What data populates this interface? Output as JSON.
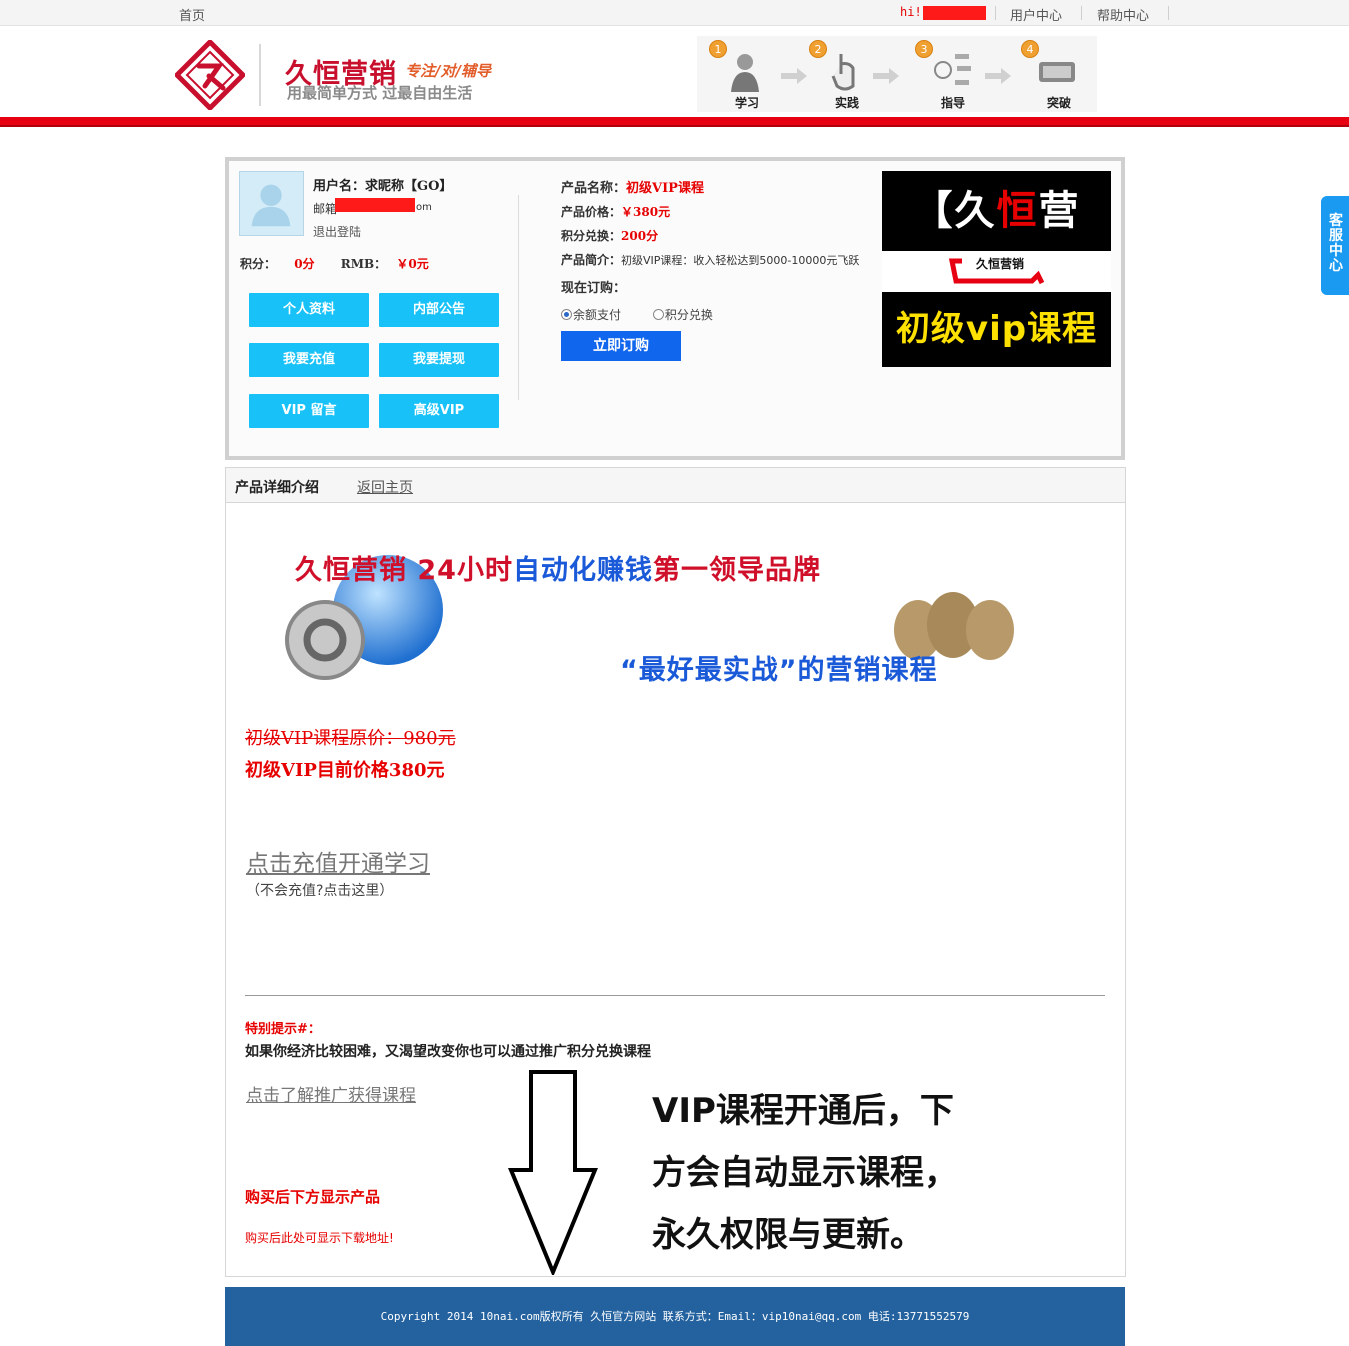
{
  "topbar": {
    "home": "首页",
    "greeting": "hi!",
    "user_center": "用户中心",
    "help_center": "帮助中心"
  },
  "header": {
    "brand": "久恒营销",
    "brand_slogan": "专注/对/辅导",
    "tagline": "用最简单方式 过最自由生活",
    "steps": [
      {
        "num": "1",
        "label": "学习"
      },
      {
        "num": "2",
        "label": "实践"
      },
      {
        "num": "3",
        "label": "指导"
      },
      {
        "num": "4",
        "label": "突破"
      }
    ]
  },
  "side_tab": "客服中心",
  "user": {
    "username": "用户名：求昵称【GO】",
    "email_label": "邮箱",
    "email_tail": "om",
    "logout": "退出登陆",
    "points_label": "积分：",
    "points_value": "0分",
    "rmb_label": "RMB：",
    "rmb_value": "￥0元"
  },
  "actions": {
    "profile": "个人资料",
    "notice": "内部公告",
    "recharge": "我要充值",
    "withdraw": "我要提现",
    "vip_message": "VIP 留言",
    "senior_vip": "高级VIP"
  },
  "product": {
    "name_label": "产品名称：",
    "name_value": "初级VIP课程",
    "price_label": "产品价格：",
    "price_value": "￥380元",
    "points_label": "积分兑换：",
    "points_value": "200分",
    "intro_label": "产品简介：",
    "intro_value": "初级VIP课程：收入轻松达到5000-10000元飞跃",
    "order_label": "现在订购：",
    "pay_balance": "余额支付",
    "pay_points": "积分兑换",
    "buy_button": "立即订购"
  },
  "ad": {
    "top_left": "【久",
    "top_accent": "恒",
    "top_right": "营销】",
    "mid": "久恒营销",
    "bottom": "初级vip课程"
  },
  "detail": {
    "tab_active": "产品详细介绍",
    "tab_back": "返回主页",
    "banner_title_red": "久恒营销 24小时",
    "banner_title_blue": "自动化赚钱",
    "banner_title_red2": "第一领导品牌",
    "banner_sub": "“最好最实战”的营销课程",
    "original_price": "初级VIP课程原价：980元",
    "current_price": "初级VIP目前价格380元",
    "recharge_link": "点击充值开通学习",
    "recharge_hint": "（不会充值?点击这里）",
    "tip_title": "特别提示#：",
    "tip_body": "如果你经济比较困难，又渴望改变你也可以通过推广积分兑换课程",
    "promo_link": "点击了解推广获得课程",
    "after_buy": "购买后下方显示产品",
    "after_buy_small": "购买后此处可显示下载地址!",
    "note_lines": [
      "VIP课程开通后，下",
      "方会自动显示课程，",
      "永久权限与更新。"
    ]
  },
  "footer": {
    "text": "Copyright 2014 10nai.com版权所有 久恒官方网站 联系方式：Email：vip10nai@qq.com 电话:13771552579"
  },
  "colors": {
    "brand_red": "#e60012",
    "button_cyan": "#18c2f8",
    "buy_blue": "#1166ee",
    "footer_blue": "#23629f"
  }
}
